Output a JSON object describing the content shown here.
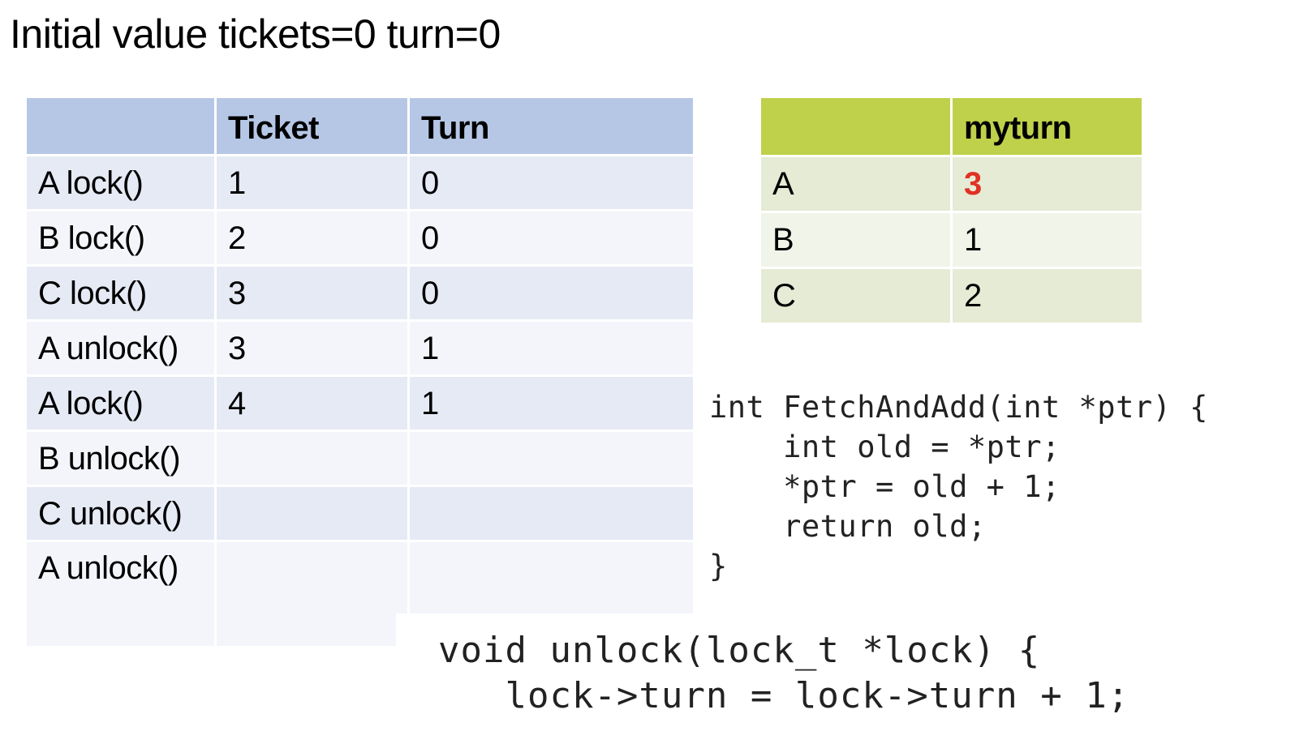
{
  "title": "Initial value tickets=0 turn=0",
  "ticket_table": {
    "headers": [
      "",
      "Ticket",
      "Turn"
    ],
    "rows": [
      [
        "A lock()",
        "1",
        "0"
      ],
      [
        "B lock()",
        "2",
        "0"
      ],
      [
        "C lock()",
        "3",
        "0"
      ],
      [
        "A unlock()",
        "3",
        "1"
      ],
      [
        "A lock()",
        "4",
        "1"
      ],
      [
        "B unlock()",
        "",
        ""
      ],
      [
        "C unlock()",
        "",
        ""
      ],
      [
        "A unlock()",
        "",
        ""
      ]
    ]
  },
  "myturn_table": {
    "headers": [
      "",
      "myturn"
    ],
    "rows": [
      [
        "A",
        "3"
      ],
      [
        "B",
        "1"
      ],
      [
        "C",
        "2"
      ]
    ],
    "highlight_color": "#e03124"
  },
  "code": {
    "fetch_and_add": "int FetchAndAdd(int *ptr) {\n    int old = *ptr;\n    *ptr = old + 1;\n    return old;\n}",
    "unlock": "void unlock(lock_t *lock) {\n   lock->turn = lock->turn + 1;"
  },
  "colors": {
    "ticket_header": "#b6c7e6",
    "ticket_row_dark": "#e6eaf5",
    "ticket_row_light": "#f3f5fa",
    "myturn_header": "#bfd04b",
    "myturn_row_dark": "#e5ebd4",
    "myturn_row_light": "#f1f4e9"
  }
}
